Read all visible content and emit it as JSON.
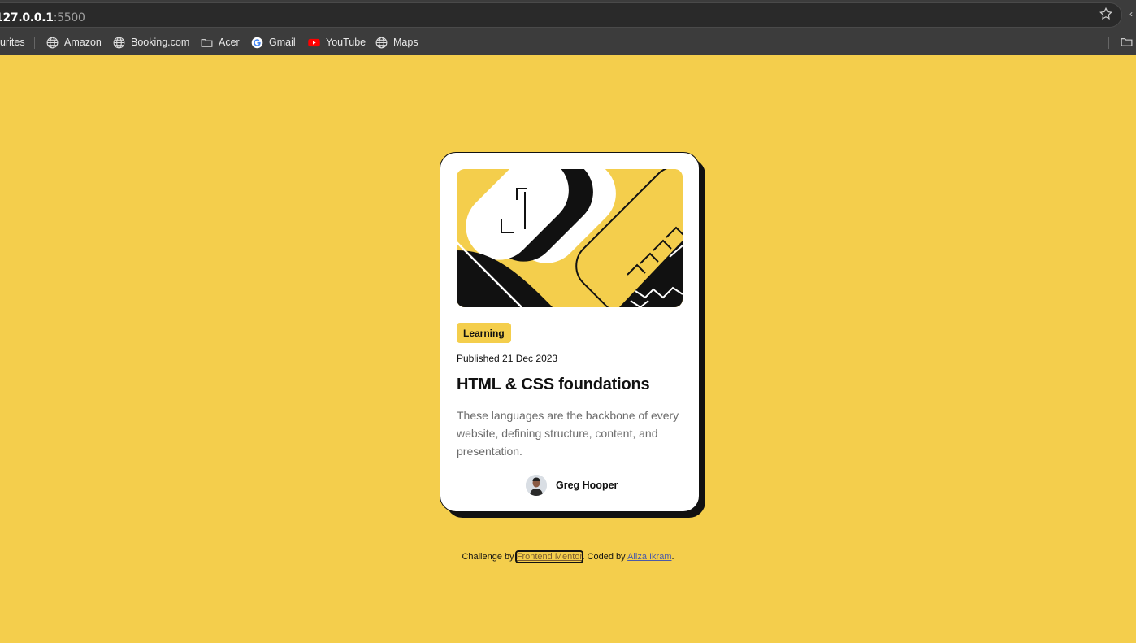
{
  "browser": {
    "url_host": "127.0.0.1",
    "url_port": ":5500",
    "bookmarks_folder_partial": "urites",
    "bookmarks": [
      {
        "label": "Amazon",
        "icon": "globe-icon"
      },
      {
        "label": "Booking.com",
        "icon": "globe-icon"
      },
      {
        "label": "Acer",
        "icon": "folder-icon"
      },
      {
        "label": "Gmail",
        "icon": "google-icon"
      },
      {
        "label": "YouTube",
        "icon": "youtube-icon"
      },
      {
        "label": "Maps",
        "icon": "globe-icon"
      }
    ]
  },
  "card": {
    "tag": "Learning",
    "published": "Published 21 Dec 2023",
    "title": "HTML & CSS foundations",
    "description": "These languages are the backbone of every website, defining structure, content, and presentation.",
    "author": "Greg Hooper"
  },
  "attribution": {
    "prefix": "Challenge by",
    "link1": "Frontend Mentor",
    "middle": ". Coded by",
    "link2": "Aliza Ikram",
    "suffix": "."
  },
  "colors": {
    "background": "#f4ce4c",
    "card": "#ffffff",
    "ink": "#111111",
    "muted": "#6b6b6b"
  }
}
